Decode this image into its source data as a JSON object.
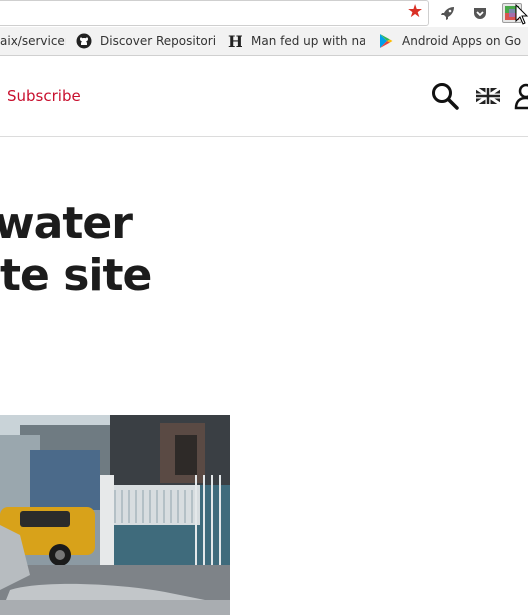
{
  "browser": {
    "bookmarks": [
      {
        "label": "aix/servicem",
        "icon": "page-icon"
      },
      {
        "label": "Discover Repositorie",
        "icon": "github-icon"
      },
      {
        "label": "Man fed up with nag",
        "icon": "newspaper-logo-icon"
      },
      {
        "label": "Android Apps on Go",
        "icon": "google-play-icon"
      }
    ],
    "toolbar_icons": [
      "star-icon",
      "rocket-icon",
      "pocket-icon",
      "flag-extension-icon"
    ]
  },
  "header": {
    "subscribe_label": "Subscribe",
    "icons": [
      "search-icon",
      "uk-flag-icon",
      "user-icon"
    ],
    "accent_color": "#c8102e"
  },
  "article": {
    "headline_line1": "water",
    "headline_line2": "te site"
  }
}
